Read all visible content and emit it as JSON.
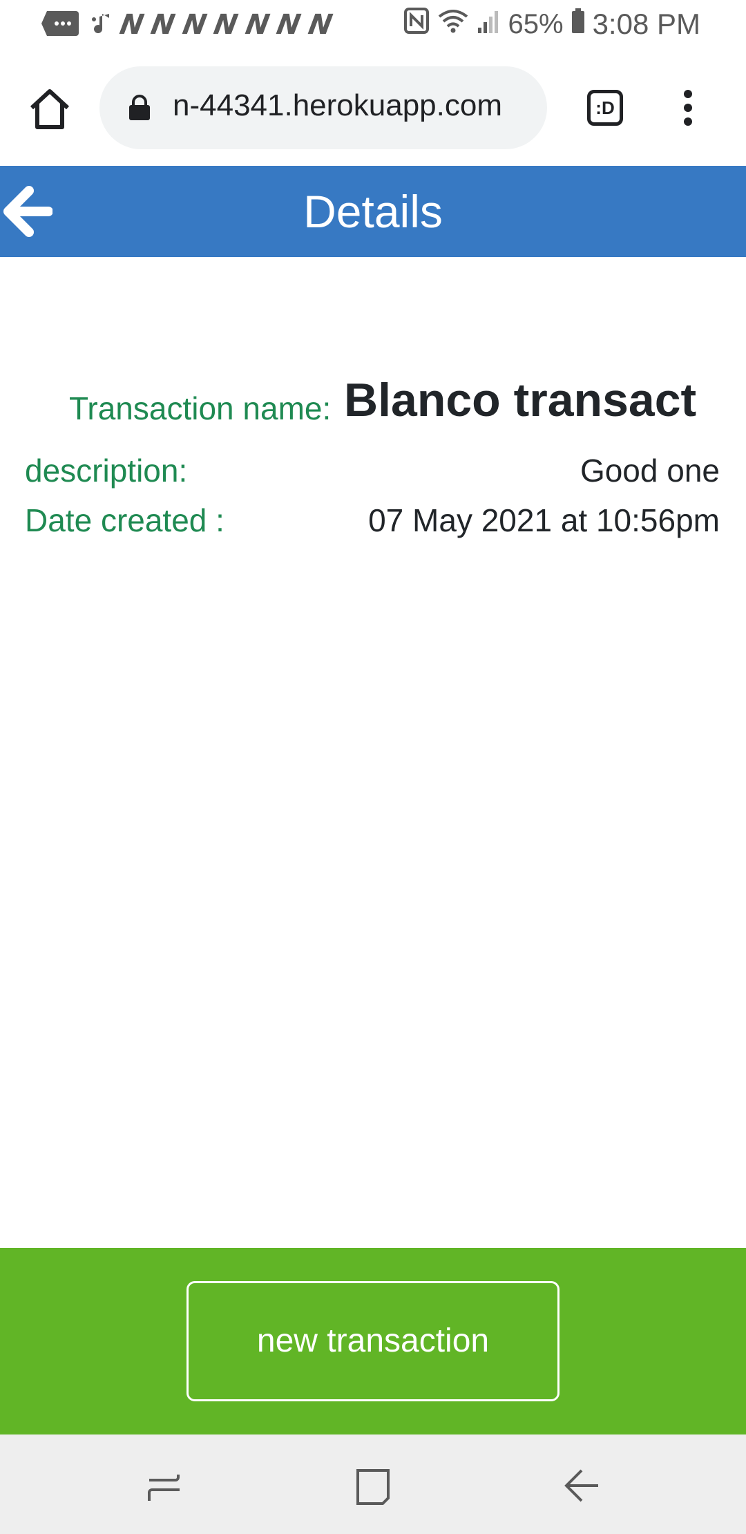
{
  "status_bar": {
    "battery": "65%",
    "time": "3:08 PM",
    "notification_icons": [
      "message-icon",
      "music-icon",
      "netflix-icon",
      "netflix-icon",
      "netflix-icon",
      "netflix-icon",
      "netflix-icon",
      "netflix-icon",
      "netflix-icon"
    ],
    "n_glyph": "N"
  },
  "browser": {
    "url": "n-44341.herokuapp.com",
    "tab_switch_label": ":D"
  },
  "header": {
    "title": "Details"
  },
  "details": {
    "name_label": "Transaction name:",
    "name_value": "Blanco transact",
    "description_label": "description:",
    "description_value": "Good one",
    "date_label": "Date created :",
    "date_value": "07 May 2021 at 10:56pm"
  },
  "footer": {
    "new_transaction_label": "new transaction"
  },
  "colors": {
    "header_bg": "#3779c3",
    "footer_bg": "#61b526",
    "label_green": "#1f8a52"
  }
}
